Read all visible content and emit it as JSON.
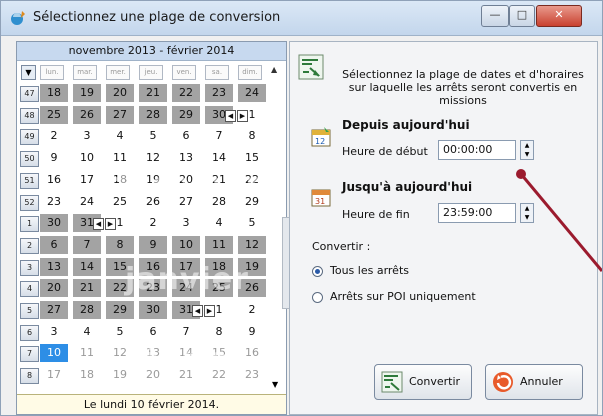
{
  "window": {
    "title": "Sélectionnez une plage de conversion",
    "minimize_glyph": "—",
    "maximize_glyph": "□",
    "close_glyph": "✕"
  },
  "calendar": {
    "range_label": "novembre 2013 - février 2014",
    "day_headers": [
      "lun.",
      "mar.",
      "mer.",
      "jeu.",
      "ven.",
      "sa.",
      "dim."
    ],
    "week_numbers": [
      "47",
      "48",
      "49",
      "50",
      "51",
      "52",
      "1",
      "2",
      "3",
      "4",
      "5",
      "6",
      "7",
      "8"
    ],
    "rows": [
      [
        "18",
        "19",
        "20",
        "21",
        "22",
        "23",
        "24"
      ],
      [
        "25",
        "26",
        "27",
        "28",
        "29",
        "30",
        "1"
      ],
      [
        "2",
        "3",
        "4",
        "5",
        "6",
        "7",
        "8"
      ],
      [
        "9",
        "10",
        "11",
        "12",
        "13",
        "14",
        "15"
      ],
      [
        "16",
        "17",
        "18",
        "19",
        "20",
        "21",
        "22"
      ],
      [
        "23",
        "24",
        "25",
        "26",
        "27",
        "28",
        "29"
      ],
      [
        "30",
        "31",
        "1",
        "2",
        "3",
        "4",
        "5"
      ],
      [
        "6",
        "7",
        "8",
        "9",
        "10",
        "11",
        "12"
      ],
      [
        "13",
        "14",
        "15",
        "16",
        "17",
        "18",
        "19"
      ],
      [
        "20",
        "21",
        "22",
        "23",
        "24",
        "25",
        "26"
      ],
      [
        "27",
        "28",
        "29",
        "30",
        "31",
        "1",
        "2"
      ],
      [
        "3",
        "4",
        "5",
        "6",
        "7",
        "8",
        "9"
      ],
      [
        "10",
        "11",
        "12",
        "13",
        "14",
        "15",
        "16"
      ],
      [
        "17",
        "18",
        "19",
        "20",
        "21",
        "22",
        "23"
      ]
    ],
    "watermarks": [
      "décembre",
      "janvier",
      "février"
    ],
    "footer": "Le lundi 10 février 2014."
  },
  "panel": {
    "description": [
      "Sélectionnez la plage de dates et d'horaires",
      "sur laquelle les arrêts seront convertis en",
      "missions"
    ],
    "start_heading": "Depuis aujourd'hui",
    "start_label": "Heure de début",
    "start_value": "00:00:00",
    "end_heading": "Jusqu'à aujourd'hui",
    "end_label": "Heure de fin",
    "end_value": "23:59:00",
    "convert_label": "Convertir :",
    "option_all": "Tous les arrêts",
    "option_poi": "Arrêts sur POI uniquement",
    "selected_option": "Tous les arrêts",
    "convert_button": "Convertir",
    "cancel_button": "Annuler"
  },
  "colors": {
    "arrow": "#9b1b2e",
    "selected_day": "#2d8ee6",
    "grey_block": "#a3a3a3"
  }
}
